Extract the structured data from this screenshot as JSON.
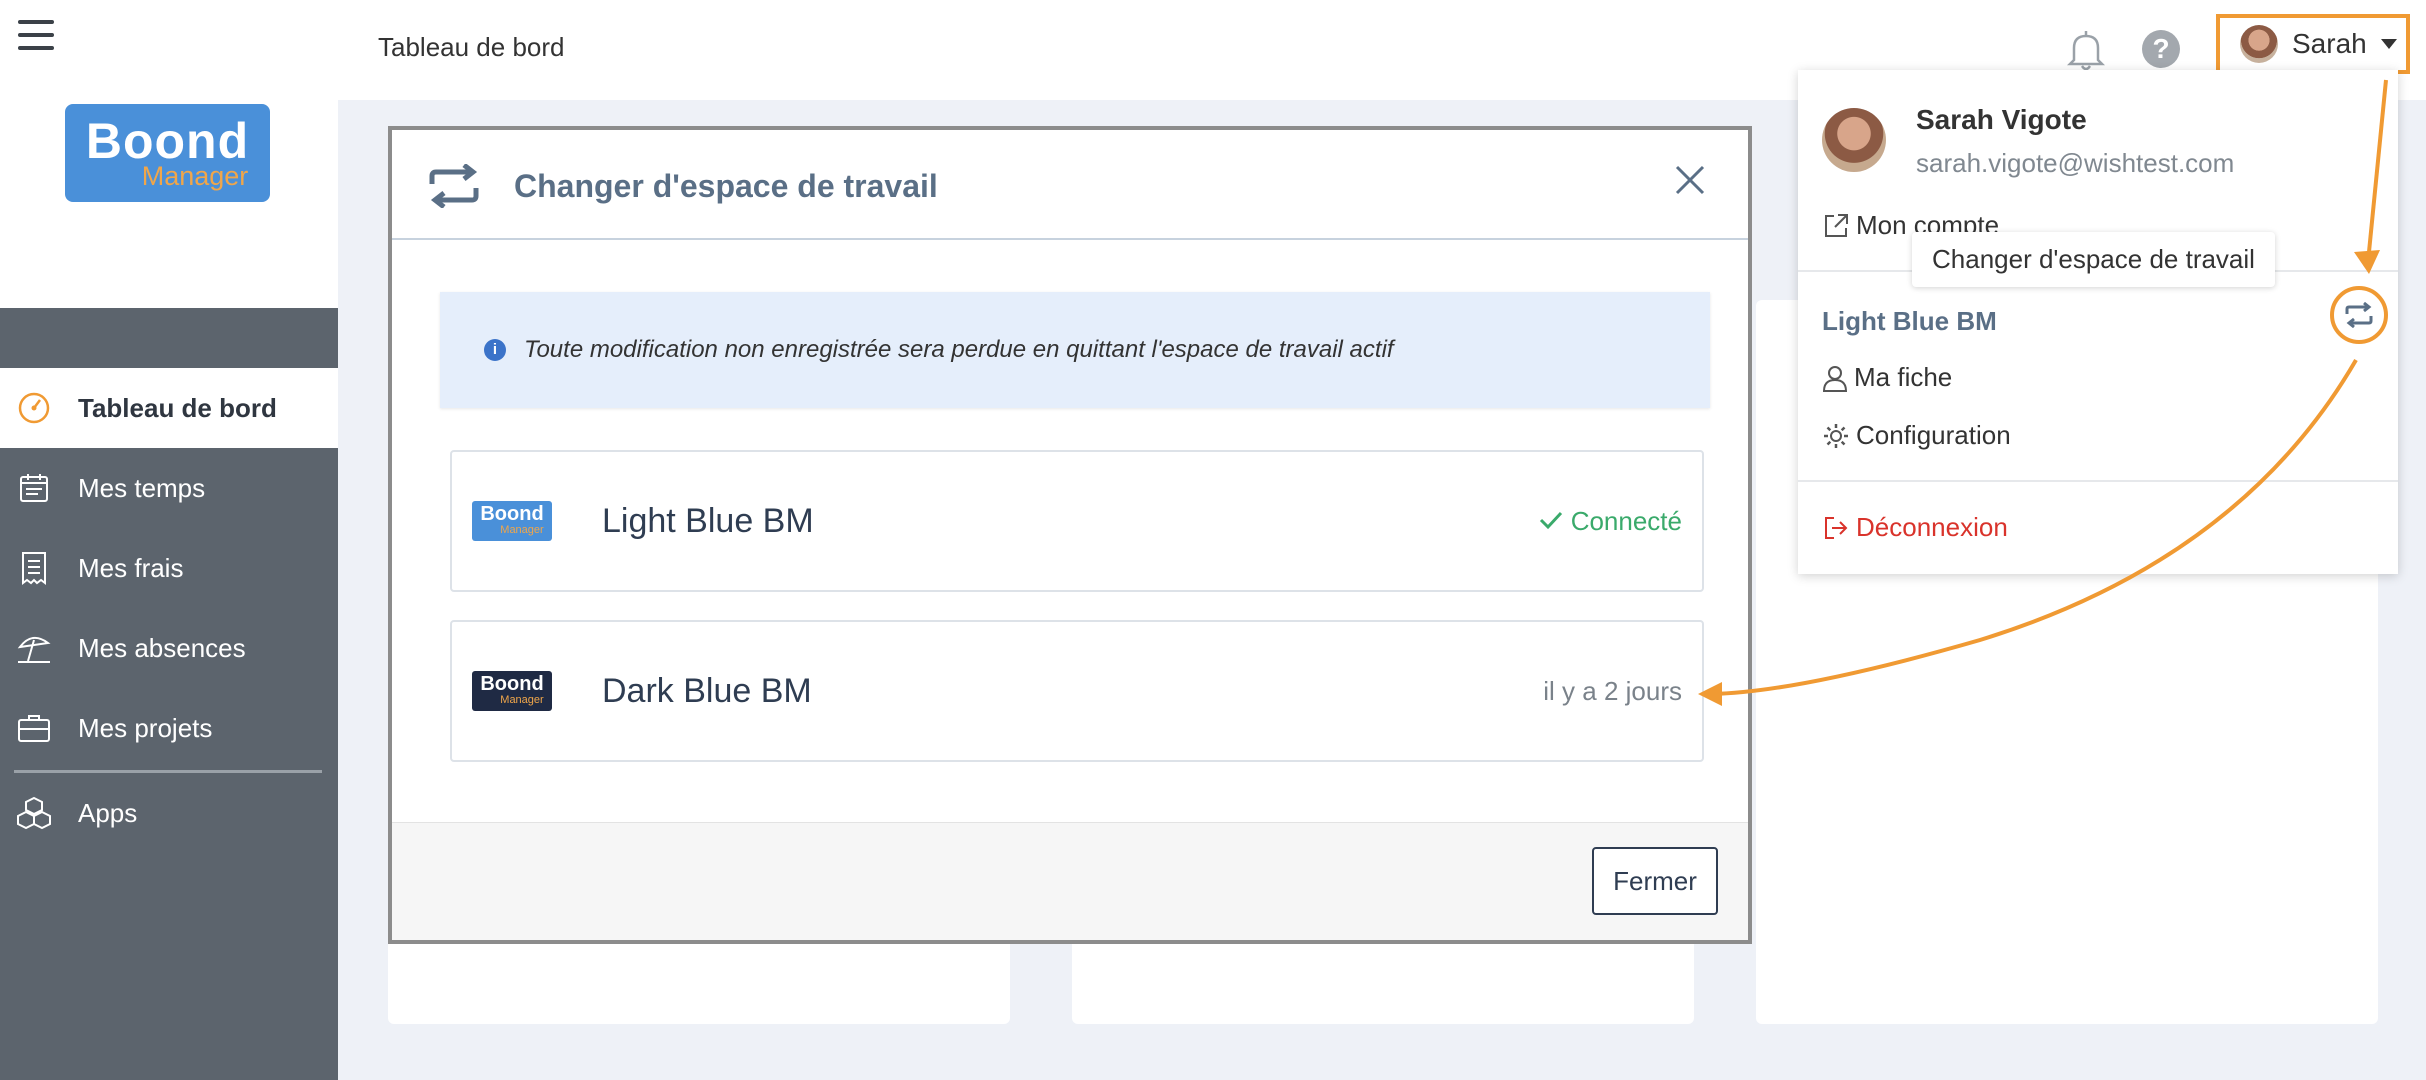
{
  "sidebar": {
    "logo": {
      "brand": "Boond",
      "sub": "Manager"
    },
    "items": [
      {
        "label": "Tableau de bord",
        "icon": "dashboard-icon",
        "active": true
      },
      {
        "label": "Mes temps",
        "icon": "calendar-icon"
      },
      {
        "label": "Mes frais",
        "icon": "receipt-icon"
      },
      {
        "label": "Mes absences",
        "icon": "umbrella-icon"
      },
      {
        "label": "Mes projets",
        "icon": "briefcase-icon"
      },
      {
        "label": "Apps",
        "icon": "cubes-icon"
      }
    ]
  },
  "header": {
    "title": "Tableau de bord",
    "help_label": "?",
    "user_name": "Sarah"
  },
  "modal": {
    "title": "Changer d'espace de travail",
    "info": "Toute modification non enregistrée sera perdue en quittant l'espace de travail actif",
    "workspaces": [
      {
        "name": "Light Blue BM",
        "status": "Connecté",
        "logo_color": "#4a90d9",
        "status_color": "#3aaa6b"
      },
      {
        "name": "Dark Blue BM",
        "status": "il y a 2 jours",
        "logo_color": "#1f2a44",
        "status_color": "#7a828a"
      }
    ],
    "close_label": "Fermer"
  },
  "dropdown": {
    "full_name": "Sarah Vigote",
    "email": "sarah.vigote@wishtest.com",
    "account": "Mon compte",
    "tooltip": "Changer d'espace de travail",
    "current_workspace": "Light Blue BM",
    "profile": "Ma fiche",
    "configuration": "Configuration",
    "logout": "Déconnexion"
  },
  "colors": {
    "accent_orange": "#f09a33",
    "logout_red": "#d9332b",
    "sidebar": "#5c646d"
  }
}
